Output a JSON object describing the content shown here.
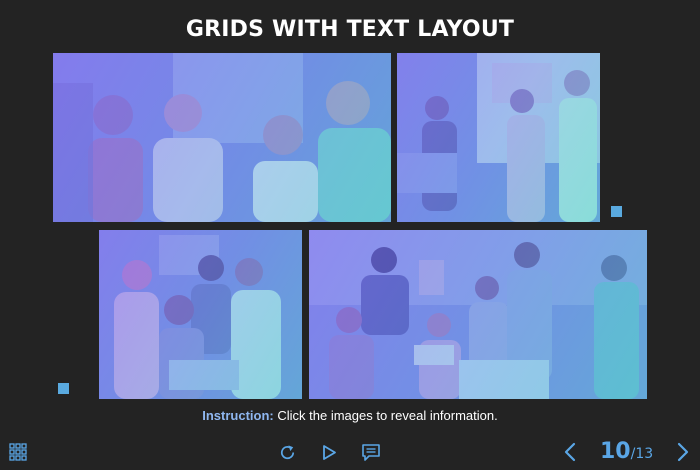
{
  "title": "GRIDS WITH TEXT LAYOUT",
  "instruction": {
    "label": "Instruction:",
    "text": " Click the images to reveal information."
  },
  "photos": [
    {
      "icon": "team-meeting-photo"
    },
    {
      "icon": "whiteboard-discussion-photo"
    },
    {
      "icon": "group-laptop-photo"
    },
    {
      "icon": "team-gathering-photo"
    }
  ],
  "pager": {
    "current": "10",
    "total": "/13"
  },
  "controls": {
    "menu_icon": "grid-menu-icon",
    "replay_icon": "replay-icon",
    "play_icon": "play-icon",
    "notes_icon": "notes-icon",
    "prev_icon": "chevron-left-icon",
    "next_icon": "chevron-right-icon"
  },
  "colors": {
    "background": "#232323",
    "accent": "#5aa6e6",
    "instruction_label": "#8fb7f0"
  }
}
